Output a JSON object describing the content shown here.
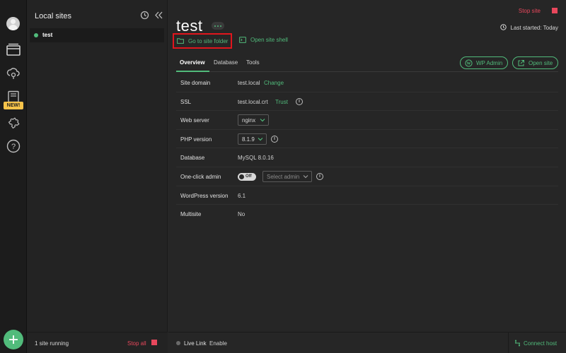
{
  "sidebar": {
    "title": "Local sites",
    "new_badge": "NEW!",
    "sites": [
      {
        "name": "test",
        "status": "running"
      }
    ],
    "footer": {
      "running_text": "1 site running",
      "stop_all": "Stop all"
    }
  },
  "site": {
    "name": "test",
    "stop_site": "Stop site",
    "last_started": "Last started: Today",
    "go_to_folder": "Go to site folder",
    "open_shell": "Open site shell",
    "tabs": [
      "Overview",
      "Database",
      "Tools"
    ],
    "active_tab": "Overview",
    "wp_admin": "WP Admin",
    "open_site": "Open site",
    "details": {
      "site_domain": {
        "label": "Site domain",
        "value": "test.local",
        "action": "Change"
      },
      "ssl": {
        "label": "SSL",
        "value": "test.local.crt",
        "action": "Trust"
      },
      "web_server": {
        "label": "Web server",
        "value": "nginx"
      },
      "php_version": {
        "label": "PHP version",
        "value": "8.1.9"
      },
      "database": {
        "label": "Database",
        "value": "MySQL 8.0.16"
      },
      "one_click_admin": {
        "label": "One-click admin",
        "toggle": "off",
        "select_placeholder": "Select admin"
      },
      "wp_version": {
        "label": "WordPress version",
        "value": "6.1"
      },
      "multisite": {
        "label": "Multisite",
        "value": "No"
      }
    }
  },
  "bottom": {
    "live_link": "Live Link",
    "enable": "Enable",
    "connect_host": "Connect host"
  },
  "colors": {
    "accent": "#51bb7b",
    "danger": "#e8475c",
    "highlight": "#e0161d",
    "badge": "#f6c34a"
  }
}
